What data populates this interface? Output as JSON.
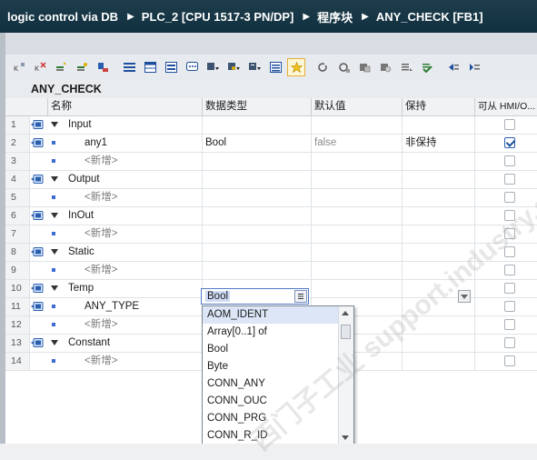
{
  "breadcrumb": [
    "logic control via DB",
    "PLC_2 [CPU 1517-3 PN/DP]",
    "程序块",
    "ANY_CHECK [FB1]"
  ],
  "block_title": "ANY_CHECK",
  "columns": {
    "name": "名称",
    "datatype": "数据类型",
    "default": "默认值",
    "retain": "保持",
    "hmi": "可从 HMI/O..."
  },
  "rows": [
    {
      "num": "1",
      "label": "Input",
      "kind": "section"
    },
    {
      "num": "2",
      "label": "any1",
      "kind": "var",
      "datatype": "Bool",
      "default": "false",
      "retain": "非保持",
      "hmi": true
    },
    {
      "num": "3",
      "label": "<新增>",
      "kind": "new"
    },
    {
      "num": "4",
      "label": "Output",
      "kind": "section"
    },
    {
      "num": "5",
      "label": "<新增>",
      "kind": "new"
    },
    {
      "num": "6",
      "label": "InOut",
      "kind": "section"
    },
    {
      "num": "7",
      "label": "<新增>",
      "kind": "new"
    },
    {
      "num": "8",
      "label": "Static",
      "kind": "section"
    },
    {
      "num": "9",
      "label": "<新增>",
      "kind": "new"
    },
    {
      "num": "10",
      "label": "Temp",
      "kind": "section"
    },
    {
      "num": "11",
      "label": "ANY_TYPE",
      "kind": "var"
    },
    {
      "num": "12",
      "label": "<新增>",
      "kind": "new"
    },
    {
      "num": "13",
      "label": "Constant",
      "kind": "section"
    },
    {
      "num": "14",
      "label": "<新增>",
      "kind": "new"
    }
  ],
  "edit_value": "Bool",
  "dropdown_options": [
    "AOM_IDENT",
    "Array[0..1] of",
    "Bool",
    "Byte",
    "CONN_ANY",
    "CONN_OUC",
    "CONN_PRG",
    "CONN_R_ID"
  ],
  "watermark": "西门子工业 support.industry.siemens.com/cs  技术论坛",
  "colors": {
    "titlebar": "#1f3d4c",
    "accent": "#3b6bd1",
    "selection": "#dce6f7"
  }
}
